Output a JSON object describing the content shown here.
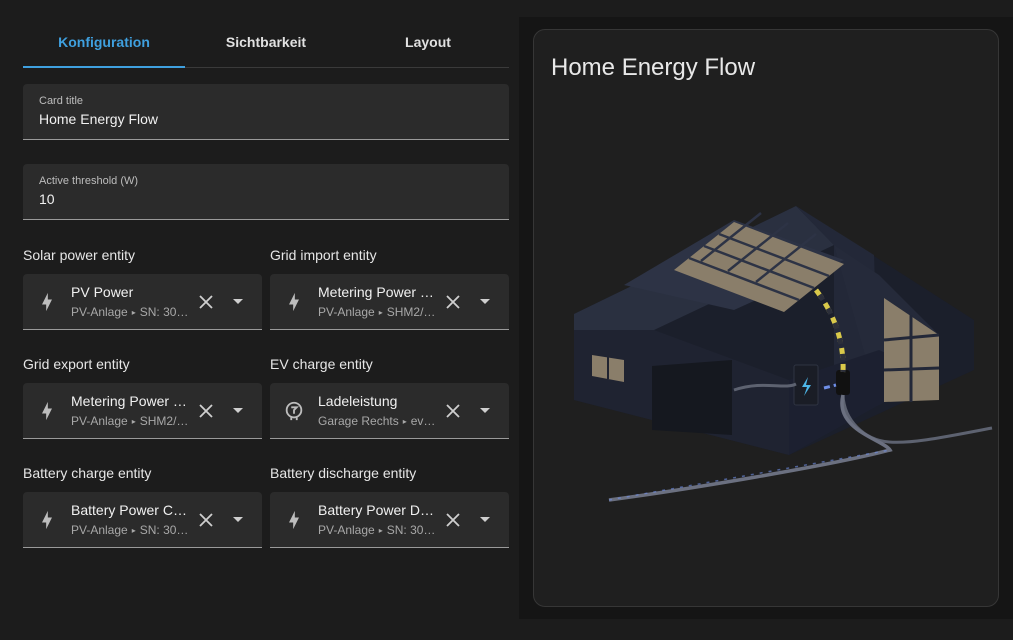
{
  "tabs": [
    {
      "label": "Konfiguration",
      "active": true
    },
    {
      "label": "Sichtbarkeit",
      "active": false
    },
    {
      "label": "Layout",
      "active": false
    }
  ],
  "fields": {
    "card_title": {
      "label": "Card title",
      "value": "Home Energy Flow"
    },
    "threshold": {
      "label": "Active threshold (W)",
      "value": "10"
    }
  },
  "entities": [
    {
      "title": "Solar power entity",
      "name": "PV Power",
      "area": "PV-Anlage",
      "device": "SN: 30…",
      "icon": "lightning-bolt-icon"
    },
    {
      "title": "Grid import entity",
      "name": "Metering Power …",
      "area": "PV-Anlage",
      "device": "SHM2/…",
      "icon": "lightning-bolt-icon"
    },
    {
      "title": "Grid export entity",
      "name": "Metering Power …",
      "area": "PV-Anlage",
      "device": "SHM2/…",
      "icon": "lightning-bolt-icon"
    },
    {
      "title": "EV charge entity",
      "name": "Ladeleistung",
      "area": "Garage Rechts",
      "device": "ev…",
      "icon": "ev-station-icon"
    },
    {
      "title": "Battery charge entity",
      "name": "Battery Power Ch…",
      "area": "PV-Anlage",
      "device": "SN: 30…",
      "icon": "lightning-bolt-icon"
    },
    {
      "title": "Battery discharge entity",
      "name": "Battery Power Di…",
      "area": "PV-Anlage",
      "device": "SN: 30…",
      "icon": "lightning-bolt-icon"
    }
  ],
  "preview": {
    "title": "Home Energy Flow"
  },
  "colors": {
    "accent": "#3fa0df",
    "solar_flow": "#d9c94a",
    "battery_flow": "#6f8fe8"
  }
}
